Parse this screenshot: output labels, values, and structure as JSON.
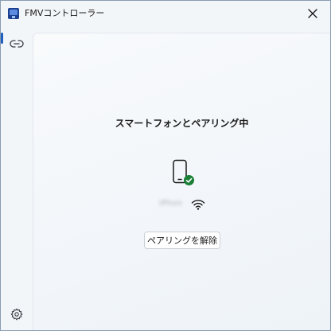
{
  "window": {
    "title": "FMVコントローラー",
    "close_icon": "close-icon",
    "app_icon": "fmv-controller-icon"
  },
  "sidebar": {
    "items": [
      {
        "name": "pairing",
        "icon": "link-icon",
        "selected": true
      }
    ],
    "settings_icon": "gear-icon"
  },
  "main": {
    "heading": "スマートフォンとペアリング中",
    "device": {
      "status_icon": "phone-check-icon",
      "name": "iPhone",
      "connection_icon": "wifi-icon"
    },
    "unpair_label": "ペアリングを解除"
  },
  "colors": {
    "accent": "#1f5fbf",
    "success": "#1a7f37",
    "text": "#1a1a1a"
  }
}
